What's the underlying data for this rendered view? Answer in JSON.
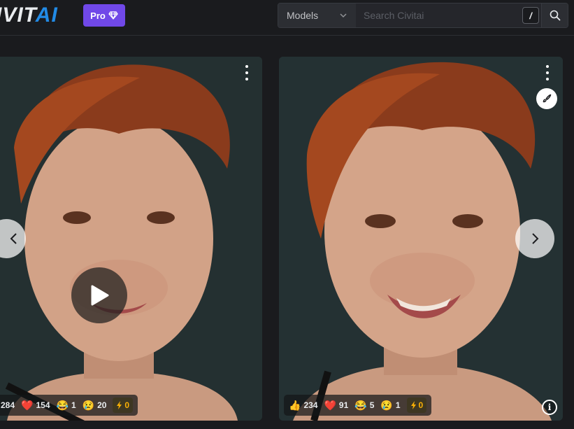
{
  "header": {
    "logo_left": "IVIT",
    "logo_right": "AI",
    "pro_label": "Pro",
    "search": {
      "category": "Models",
      "placeholder": "Search Civitai",
      "shortcut": "/"
    }
  },
  "cards": [
    {
      "media": "video",
      "reactions": [
        {
          "icon": "thumbs-up",
          "count": "284"
        },
        {
          "icon": "heart",
          "emoji": "❤️",
          "count": "154"
        },
        {
          "icon": "laugh",
          "emoji": "😂",
          "count": "1"
        },
        {
          "icon": "cry",
          "emoji": "😢",
          "count": "20"
        }
      ],
      "buzz": "0"
    },
    {
      "media": "image",
      "reactions": [
        {
          "icon": "thumbs-up",
          "emoji": "👍",
          "count": "234"
        },
        {
          "icon": "heart",
          "emoji": "❤️",
          "count": "91"
        },
        {
          "icon": "laugh",
          "emoji": "😂",
          "count": "5"
        },
        {
          "icon": "cry",
          "emoji": "😢",
          "count": "1"
        }
      ],
      "buzz": "0"
    }
  ],
  "colors": {
    "brand_blue": "#228be6",
    "pro_purple": "#7048e8",
    "buzz_yellow": "#fab005",
    "background": "#1a1b1e"
  }
}
